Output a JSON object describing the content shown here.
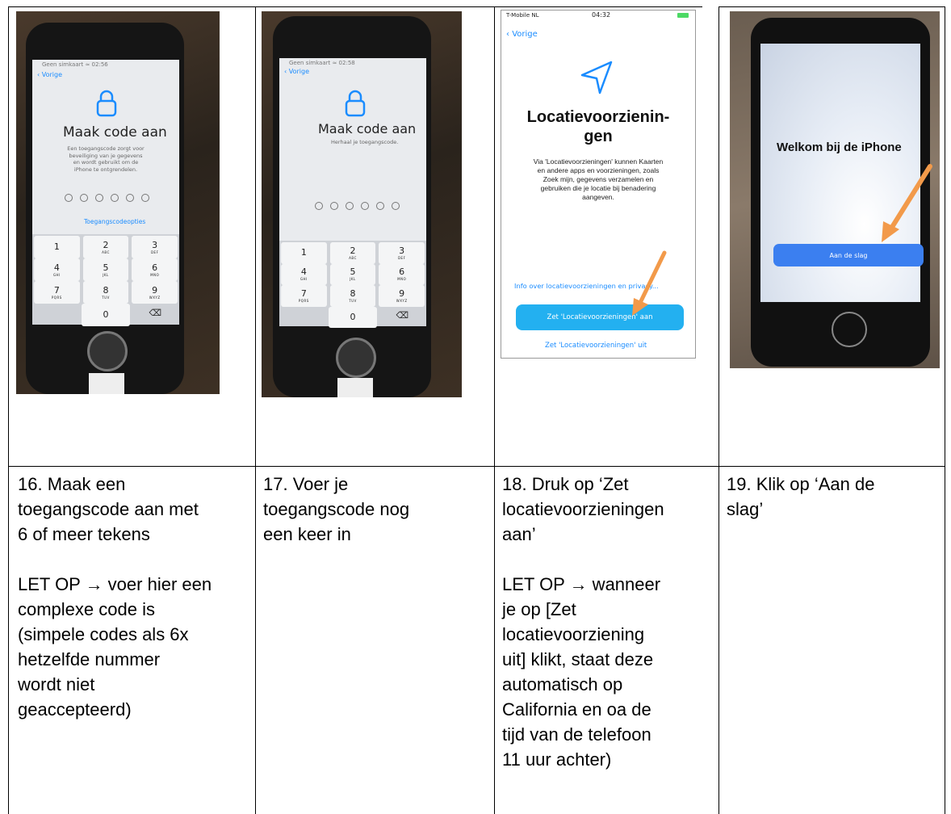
{
  "colors": {
    "accent_blue": "#1a8cff",
    "ios_button_blue": "#23b0f0",
    "arrow_orange": "#f29a4a"
  },
  "photos": {
    "p16": {
      "status": "Geen simkaart ≈  02:56",
      "back": "‹ Vorige",
      "lock_icon": "lock-icon",
      "title": "Maak code aan",
      "body": "Een toegangscode zorgt voor\nbeveiliging van je gegevens\nen wordt gebruikt om de\niPhone te ontgrendelen.",
      "options": "Toegangscodeopties",
      "keys": [
        [
          "1",
          ""
        ],
        [
          "2",
          "ABC"
        ],
        [
          "3",
          "DEF"
        ],
        [
          "4",
          "GHI"
        ],
        [
          "5",
          "JKL"
        ],
        [
          "6",
          "MNO"
        ],
        [
          "7",
          "PQRS"
        ],
        [
          "8",
          "TUV"
        ],
        [
          "9",
          "WXYZ"
        ],
        [
          "",
          ""
        ],
        [
          "0",
          ""
        ],
        [
          "⌫",
          ""
        ]
      ]
    },
    "p17": {
      "status": "Geen simkaart ≈  02:58",
      "back": "‹ Vorige",
      "title": "Maak code aan",
      "body": "Herhaal je toegangscode.",
      "keys": [
        [
          "1",
          ""
        ],
        [
          "2",
          "ABC"
        ],
        [
          "3",
          "DEF"
        ],
        [
          "4",
          "GHI"
        ],
        [
          "5",
          "JKL"
        ],
        [
          "6",
          "MNO"
        ],
        [
          "7",
          "PQRS"
        ],
        [
          "8",
          "TUV"
        ],
        [
          "9",
          "WXYZ"
        ],
        [
          "",
          ""
        ],
        [
          "0",
          ""
        ],
        [
          "⌫",
          ""
        ]
      ]
    },
    "p18": {
      "carrier": "T-Mobile NL",
      "time": "04:32",
      "back": "Vorige",
      "title_line1": "Locatievoorzienin-",
      "title_line2": "gen",
      "body": "Via 'Locatievoorzieningen' kunnen Kaarten\nen andere apps en voorzieningen, zoals\nZoek mijn, gegevens verzamelen en\ngebruiken die je locatie bij benadering\naangeven.",
      "info_link": "Info over locatievoorzieningen en privacy...",
      "on_button": "Zet 'Locatievoorzieningen' aan",
      "off_button": "Zet 'Locatievoorzieningen' uit"
    },
    "p19": {
      "welcome": "Welkom bij de iPhone",
      "start_button": "Aan de slag"
    }
  },
  "steps": [
    {
      "main": "16. Maak een\ntoegangscode aan met\n6 of meer tekens",
      "note": "LET OP → voer hier een\ncomplexe code is\n(simpele codes als 6x\nhetzelfde nummer\nwordt niet\ngeaccepteerd)"
    },
    {
      "main": "17. Voer je\ntoegangscode nog\neen keer in"
    },
    {
      "main": "18. Druk op ‘Zet\nlocatievoorzieningen\naan’",
      "note": " LET OP → wanneer\nje op [Zet\nlocatievoorziening\nuit] klikt, staat deze\nautomatisch op\nCalifornia en oa de\ntijd van de telefoon\n11 uur achter)"
    },
    {
      "main": "19. Klik op ‘Aan de\nslag’"
    }
  ]
}
